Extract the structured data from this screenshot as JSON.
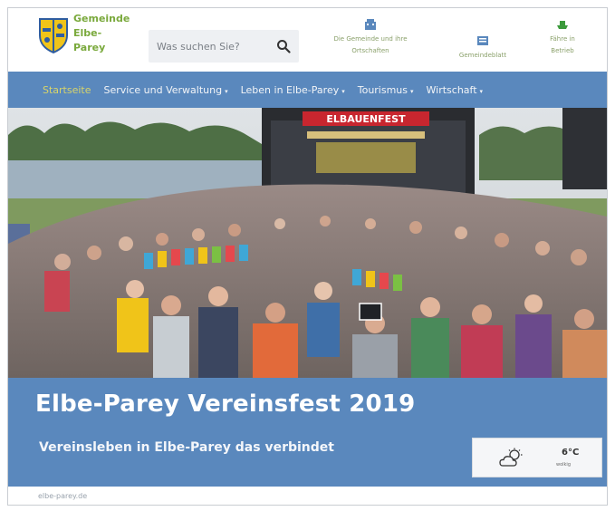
{
  "header": {
    "brand_lines": [
      "Gemeinde",
      "Elbe-",
      "Parey"
    ],
    "search": {
      "placeholder": "Was suchen Sie?",
      "icon": "search-icon"
    },
    "links": [
      {
        "label_line1": "Die Gemeinde und ihre",
        "label_line2": "Ortschaften",
        "icon": "building-icon"
      },
      {
        "label_line1": "Gemeindeblatt",
        "icon": "newspaper-icon"
      },
      {
        "label_line1": "Fähre in",
        "label_line2": "Betrieb",
        "icon": "ferry-icon"
      }
    ]
  },
  "nav": {
    "items": [
      {
        "label": "Startseite",
        "active": true,
        "has_dropdown": false
      },
      {
        "label": "Service und Verwaltung",
        "has_dropdown": true
      },
      {
        "label": "Leben in Elbe-Parey",
        "has_dropdown": true
      },
      {
        "label": "Tourismus",
        "has_dropdown": true
      },
      {
        "label": "Wirtschaft",
        "has_dropdown": true
      }
    ],
    "caret": "▾"
  },
  "hero": {
    "stage_banner": "ELBAUENFEST"
  },
  "banner": {
    "title": "Elbe-Parey Vereinsfest 2019",
    "subtitle": "Vereinsleben in Elbe-Parey das verbindet"
  },
  "weather": {
    "temperature": "6°C",
    "condition": "wolkig",
    "icon": "cloud-sun-icon"
  },
  "footer": {
    "url": "elbe-parey.de"
  },
  "colors": {
    "brand_green": "#7aa93c",
    "nav_blue": "#5a88bd",
    "active_nav": "#d8d46a"
  }
}
